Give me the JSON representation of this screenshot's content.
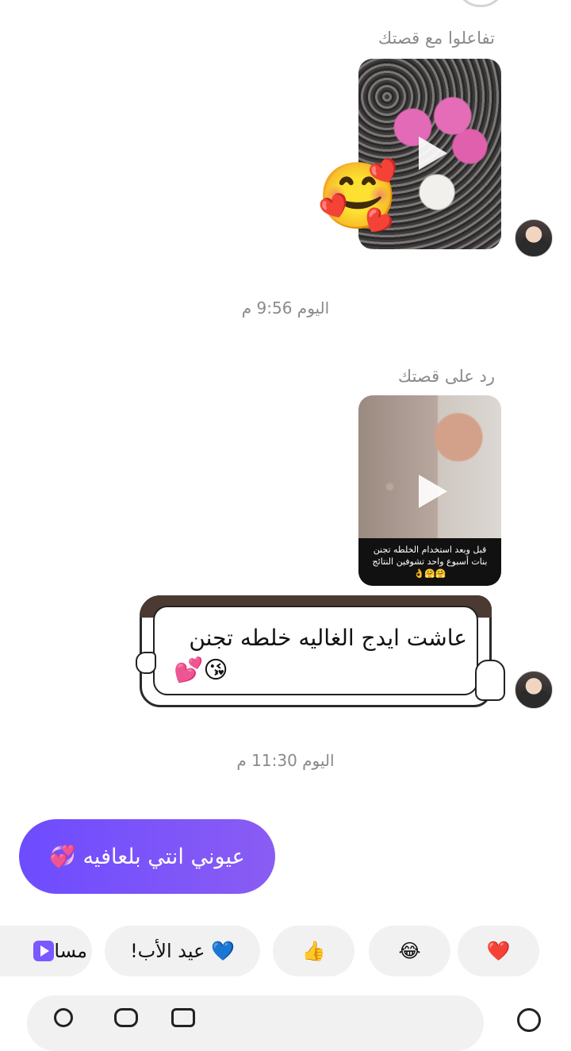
{
  "chat": {
    "story_reaction_label": "تفاعلوا مع قصتك",
    "reaction_emoji": "🥰",
    "timestamp_1": "اليوم 9:56 م",
    "story_reply_label": "رد على قصتك",
    "story2_caption_line1": "قبل وبعد استخدام الخلطه تجنن",
    "story2_caption_line2": "بنات أسبوع واحد تشوفين النتائج",
    "story2_caption_emojis": "🤗🤗👌",
    "sticker_message_text": "عاشت ايدج الغاليه خلطه تجنن",
    "sticker_message_emojis": "😘💕",
    "timestamp_2": "اليوم 11:30 م",
    "my_reply_text": "عيوني انتي بلعافيه 💞"
  },
  "quick_replies": [
    {
      "label": "❤️"
    },
    {
      "label": "😂"
    },
    {
      "label": "👍"
    },
    {
      "label": "💙 عيد الأب!"
    },
    {
      "label": "مسا"
    }
  ],
  "icons": {
    "heart": "heart-icon",
    "laugh": "laugh-emoji-icon",
    "thumbs": "thumbs-up-icon",
    "album": "media-album-icon"
  }
}
